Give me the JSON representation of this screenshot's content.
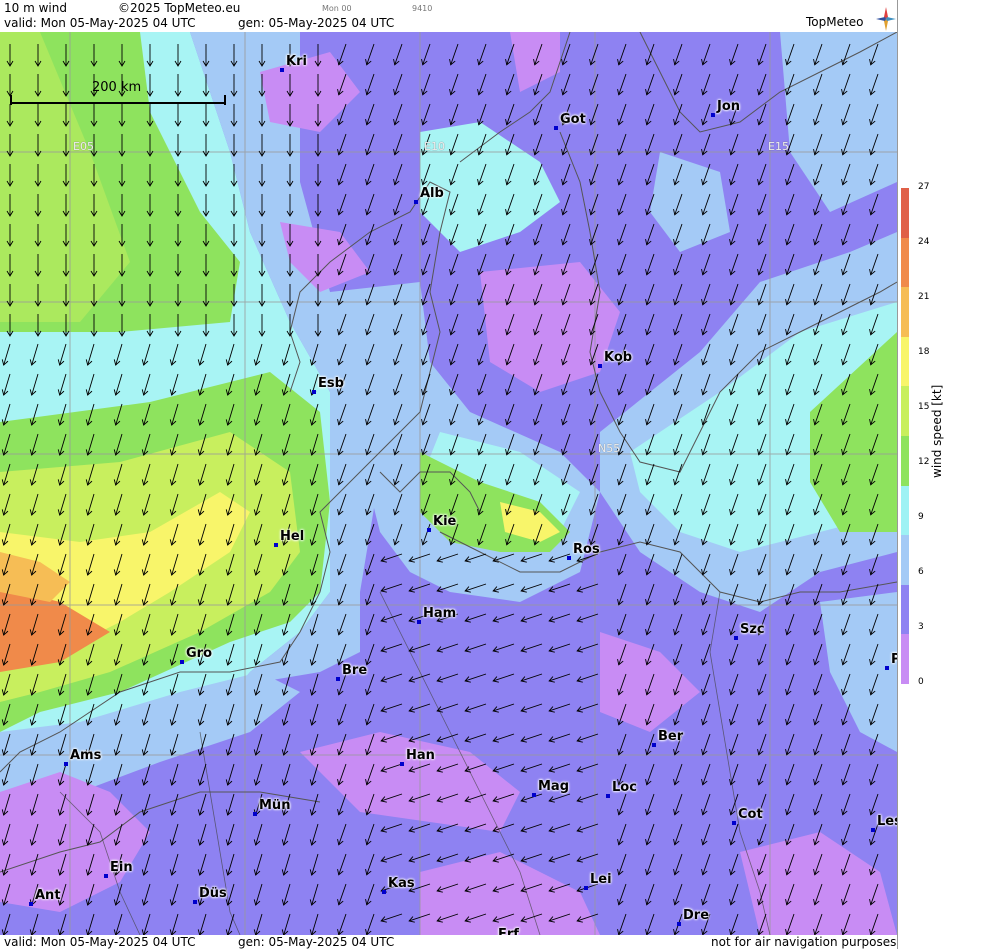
{
  "header": {
    "title": "10 m wind",
    "copyright": "©2025 TopMeteo.eu",
    "valid": "valid:  Mon  05-May-2025  04 UTC",
    "gen": "gen: 05-May-2025 04 UTC",
    "small_time": "Mon 00",
    "small_code": "9410",
    "logo": "TopMeteo"
  },
  "footer": {
    "valid": "valid:  Mon  05-May-2025  04 UTC",
    "gen": "gen: 05-May-2025 04 UTC",
    "disclaimer": "not for air navigation purposes"
  },
  "map": {
    "scale_label": "200 km",
    "grid_labels": [
      "E05",
      "E10",
      "E15",
      "N55"
    ],
    "cities": [
      "Kri",
      "Got",
      "Jon",
      "Alb",
      "Kob",
      "Esb",
      "Kie",
      "Hel",
      "Ros",
      "Ham",
      "Szc",
      "Gro",
      "Bre",
      "P",
      "Ber",
      "Ams",
      "Han",
      "Mag",
      "Loc",
      "Mün",
      "Cot",
      "Les",
      "Ein",
      "Kas",
      "Lei",
      "Ant",
      "Düs",
      "Dre",
      "Erf"
    ]
  },
  "legend": {
    "unit": "wind speed [kt]",
    "ticks": [
      "27",
      "24",
      "21",
      "18",
      "15",
      "12",
      "9",
      "6",
      "3",
      "0"
    ],
    "colors": [
      "#e06048",
      "#f08a4a",
      "#f6bd55",
      "#f8f56a",
      "#c8ef5e",
      "#8ee35e",
      "#9ef2f4",
      "#a4caf6",
      "#8e82f2",
      "#c88cf4"
    ]
  },
  "colors": {
    "purple": "#8e82f2",
    "violet": "#c88cf4",
    "lightblue": "#a4caf6",
    "cyan": "#a8f4f4",
    "green": "#8ee35e",
    "yellowgreen": "#c8ef5e",
    "yellow": "#f8f56a",
    "orange": "#f08a4a"
  }
}
